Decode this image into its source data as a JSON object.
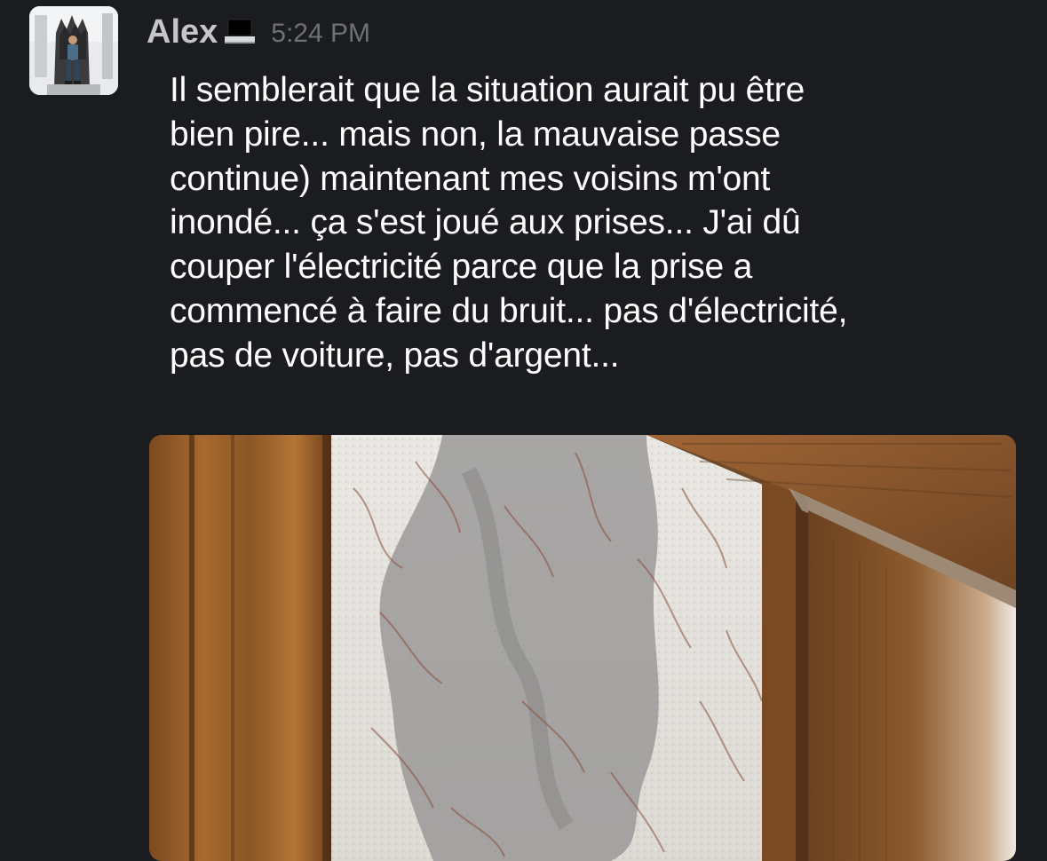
{
  "message": {
    "author": "Alex",
    "status_icon": "laptop-icon",
    "timestamp": "5:24 PM",
    "text_lines": [
      "Il semblerait que la situation aurait pu être",
      "bien pire... mais non, la mauvaise passe",
      "continue) maintenant mes voisins m'ont",
      "inondé... ça s'est joué aux prises... J'ai dû",
      "couper l'électricité parce que la prise a",
      "commencé à faire du bruit... pas d'électricité,",
      "pas de voiture, pas d'argent..."
    ],
    "attachment": {
      "kind": "photo",
      "subject": "water-stained wallpaper wall beside wooden door frame"
    }
  },
  "colors": {
    "background": "#1b1c20",
    "author": "#c5c6c9",
    "timestamp": "#6f7176",
    "text": "#ffffff"
  }
}
